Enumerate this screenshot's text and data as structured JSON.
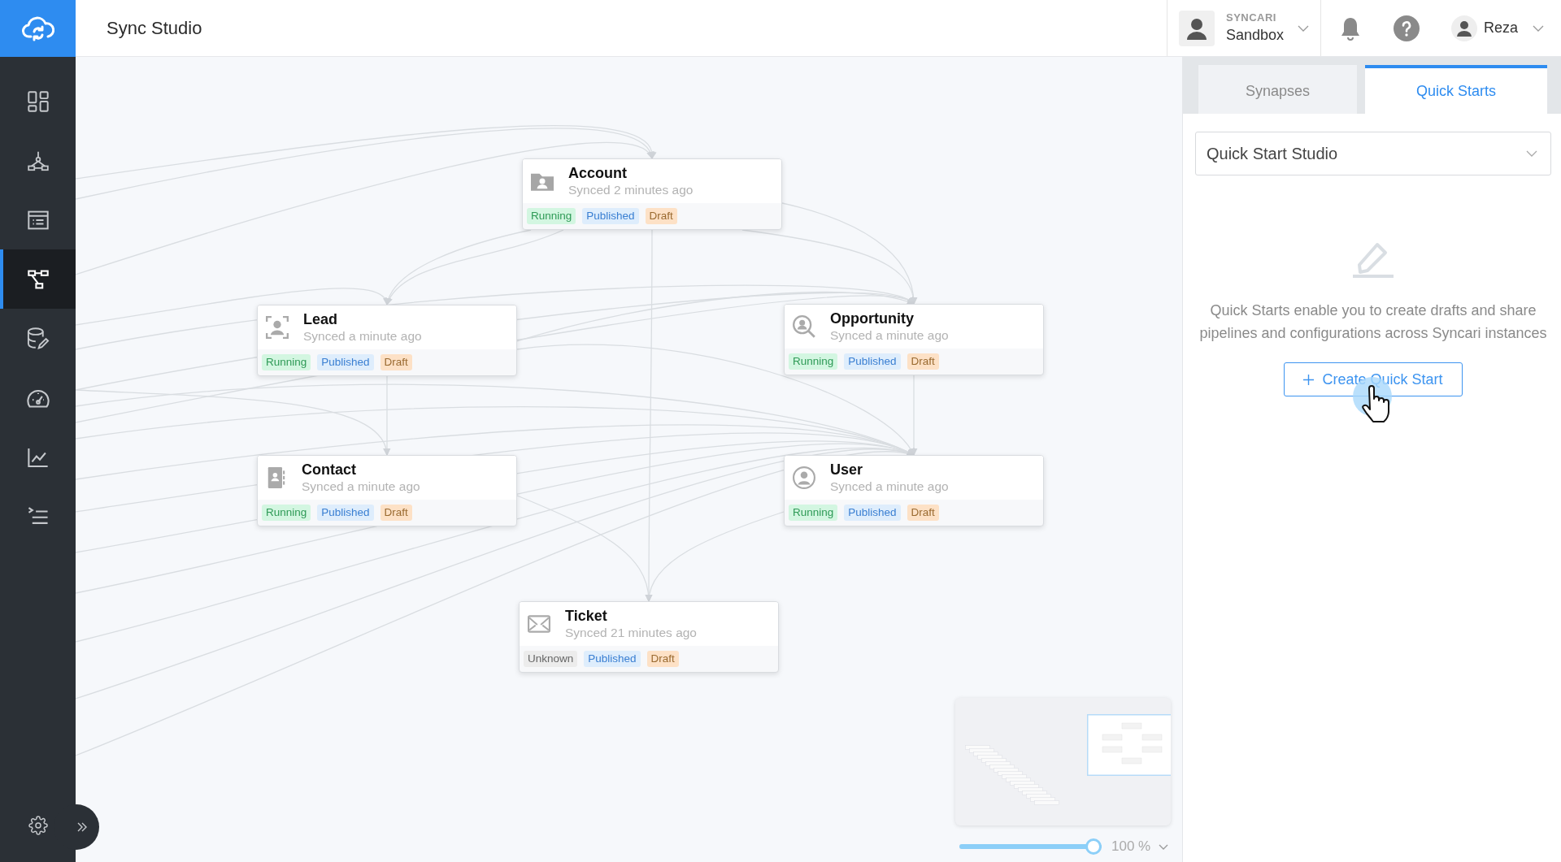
{
  "app": {
    "title": "Sync Studio"
  },
  "sidebar": {
    "items": [
      {
        "kind": "dashboard",
        "selected": false
      },
      {
        "kind": "hierarchy",
        "selected": false
      },
      {
        "kind": "list",
        "selected": false
      },
      {
        "kind": "flow",
        "selected": true
      },
      {
        "kind": "database",
        "selected": false
      },
      {
        "kind": "gauge",
        "selected": false
      },
      {
        "kind": "chart",
        "selected": false
      },
      {
        "kind": "tasks",
        "selected": false
      }
    ]
  },
  "header": {
    "org": {
      "label": "SYNCARI",
      "name": "Sandbox"
    },
    "user": {
      "name": "Reza"
    }
  },
  "canvas": {
    "nodes": [
      {
        "kind": "folder",
        "name": "Account",
        "synced": "Synced 2 minutes ago",
        "tags": [
          {
            "kind": "running",
            "label": "Running"
          },
          {
            "kind": "published",
            "label": "Published"
          },
          {
            "kind": "draft",
            "label": "Draft"
          }
        ]
      },
      {
        "kind": "scan",
        "name": "Lead",
        "synced": "Synced a minute ago",
        "tags": [
          {
            "kind": "running",
            "label": "Running"
          },
          {
            "kind": "published",
            "label": "Published"
          },
          {
            "kind": "draft",
            "label": "Draft"
          }
        ]
      },
      {
        "kind": "search",
        "name": "Opportunity",
        "synced": "Synced a minute ago",
        "tags": [
          {
            "kind": "running",
            "label": "Running"
          },
          {
            "kind": "published",
            "label": "Published"
          },
          {
            "kind": "draft",
            "label": "Draft"
          }
        ]
      },
      {
        "kind": "book",
        "name": "Contact",
        "synced": "Synced a minute ago",
        "tags": [
          {
            "kind": "running",
            "label": "Running"
          },
          {
            "kind": "published",
            "label": "Published"
          },
          {
            "kind": "draft",
            "label": "Draft"
          }
        ]
      },
      {
        "kind": "user",
        "name": "User",
        "synced": "Synced a minute ago",
        "tags": [
          {
            "kind": "running",
            "label": "Running"
          },
          {
            "kind": "published",
            "label": "Published"
          },
          {
            "kind": "draft",
            "label": "Draft"
          }
        ]
      },
      {
        "kind": "mail",
        "name": "Ticket",
        "synced": "Synced 21 minutes ago",
        "tags": [
          {
            "kind": "unknown",
            "label": "Unknown"
          },
          {
            "kind": "published",
            "label": "Published"
          },
          {
            "kind": "draft",
            "label": "Draft"
          }
        ]
      }
    ],
    "zoom": {
      "level": 1,
      "reading": "100 %"
    }
  },
  "panel": {
    "tabs": [
      {
        "label": "Synapses",
        "selected": false
      },
      {
        "label": "Quick Starts",
        "selected": true
      }
    ],
    "select": {
      "value": "Quick Start Studio"
    },
    "empty_state": {
      "text": "Quick Starts enable you to create drafts and share pipelines and configurations across Syncari instances",
      "button": "Create Quick Start"
    }
  }
}
